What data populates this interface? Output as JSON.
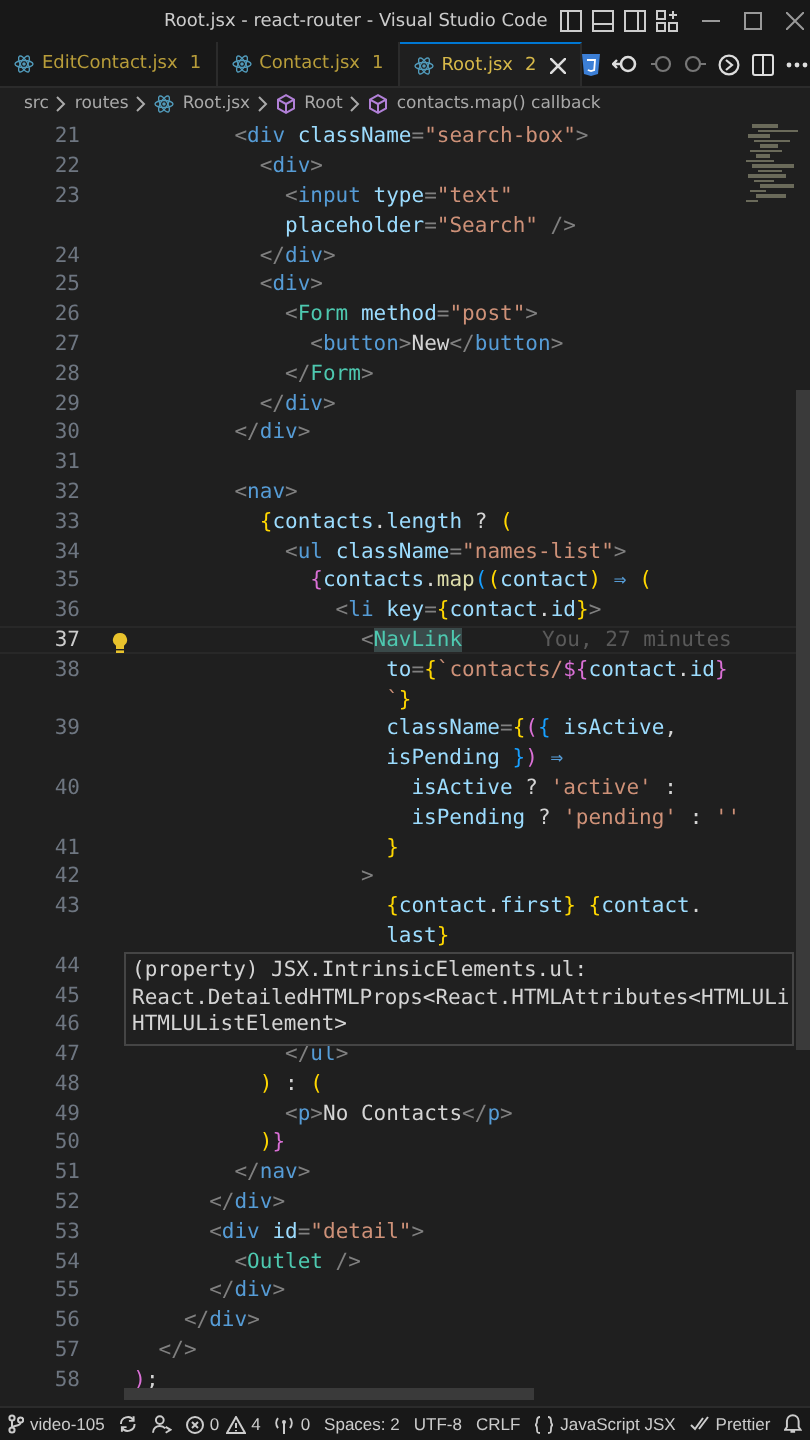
{
  "window": {
    "title": "Root.jsx - react-router - Visual Studio Code"
  },
  "tabs": [
    {
      "label": "EditContact.jsx",
      "badge": "1",
      "selected": false
    },
    {
      "label": "Contact.jsx",
      "badge": "1",
      "selected": false
    },
    {
      "label": "Root.jsx",
      "badge": "2",
      "selected": true
    }
  ],
  "breadcrumb": [
    {
      "label": "src",
      "kind": "folder"
    },
    {
      "label": "routes",
      "kind": "folder"
    },
    {
      "label": "Root.jsx",
      "kind": "file"
    },
    {
      "label": "Root",
      "kind": "symbol"
    },
    {
      "label": "contacts.map() callback",
      "kind": "symbol"
    }
  ],
  "editor": {
    "lines": [
      {
        "n": "21",
        "current": false,
        "tokens": [
          {
            "kind": "punct",
            "text": "          <"
          },
          {
            "kind": "tag",
            "text": "div"
          },
          {
            "kind": "attr",
            "text": " className"
          },
          {
            "kind": "punct",
            "text": "="
          },
          {
            "kind": "string",
            "text": "\"search-box\""
          },
          {
            "kind": "punct",
            "text": ">"
          }
        ]
      },
      {
        "n": "22",
        "current": false,
        "tokens": [
          {
            "kind": "punct",
            "text": "            <"
          },
          {
            "kind": "tag",
            "text": "div"
          },
          {
            "kind": "punct",
            "text": ">"
          }
        ]
      },
      {
        "n": "23",
        "current": false,
        "tokens": [
          {
            "kind": "punct",
            "text": "              <"
          },
          {
            "kind": "tag",
            "text": "input"
          },
          {
            "kind": "attr",
            "text": " type"
          },
          {
            "kind": "punct",
            "text": "="
          },
          {
            "kind": "string",
            "text": "\"text\""
          }
        ]
      },
      {
        "current": false,
        "tokens": [
          {
            "kind": "attr",
            "text": "              placeholder"
          },
          {
            "kind": "punct",
            "text": "="
          },
          {
            "kind": "string",
            "text": "\"Search\""
          },
          {
            "kind": "punct",
            "text": " />"
          }
        ]
      },
      {
        "n": "24",
        "current": false,
        "tokens": [
          {
            "kind": "punct",
            "text": "            </"
          },
          {
            "kind": "tag",
            "text": "div"
          },
          {
            "kind": "punct",
            "text": ">"
          }
        ]
      },
      {
        "n": "25",
        "current": false,
        "tokens": [
          {
            "kind": "punct",
            "text": "            <"
          },
          {
            "kind": "tag",
            "text": "div"
          },
          {
            "kind": "punct",
            "text": ">"
          }
        ]
      },
      {
        "n": "26",
        "current": false,
        "tokens": [
          {
            "kind": "punct",
            "text": "              <"
          },
          {
            "kind": "component",
            "text": "Form"
          },
          {
            "kind": "attr",
            "text": " method"
          },
          {
            "kind": "punct",
            "text": "="
          },
          {
            "kind": "string",
            "text": "\"post\""
          },
          {
            "kind": "punct",
            "text": ">"
          }
        ]
      },
      {
        "n": "27",
        "current": false,
        "tokens": [
          {
            "kind": "punct",
            "text": "                <"
          },
          {
            "kind": "tag",
            "text": "button"
          },
          {
            "kind": "punct",
            "text": ">"
          },
          {
            "kind": "plain",
            "text": "New"
          },
          {
            "kind": "punct",
            "text": "</"
          },
          {
            "kind": "tag",
            "text": "button"
          },
          {
            "kind": "punct",
            "text": ">"
          }
        ]
      },
      {
        "n": "28",
        "current": false,
        "tokens": [
          {
            "kind": "punct",
            "text": "              </"
          },
          {
            "kind": "component",
            "text": "Form"
          },
          {
            "kind": "punct",
            "text": ">"
          }
        ]
      },
      {
        "n": "29",
        "current": false,
        "tokens": [
          {
            "kind": "punct",
            "text": "            </"
          },
          {
            "kind": "tag",
            "text": "div"
          },
          {
            "kind": "punct",
            "text": ">"
          }
        ]
      },
      {
        "n": "30",
        "current": false,
        "tokens": [
          {
            "kind": "punct",
            "text": "          </"
          },
          {
            "kind": "tag",
            "text": "div"
          },
          {
            "kind": "punct",
            "text": ">"
          }
        ]
      },
      {
        "n": "31",
        "current": false
      },
      {
        "n": "32",
        "current": false,
        "tokens": [
          {
            "kind": "punct",
            "text": "          <"
          },
          {
            "kind": "tag",
            "text": "nav"
          },
          {
            "kind": "punct",
            "text": ">"
          }
        ]
      },
      {
        "n": "33",
        "current": false,
        "tokens": [
          {
            "kind": "bracket1",
            "text": "            {"
          },
          {
            "kind": "var",
            "text": "contacts"
          },
          {
            "kind": "plain",
            "text": "."
          },
          {
            "kind": "var",
            "text": "length"
          },
          {
            "kind": "plain",
            "text": " ? "
          },
          {
            "kind": "bracket1",
            "text": "("
          }
        ]
      },
      {
        "n": "34",
        "current": false,
        "tokens": [
          {
            "kind": "punct",
            "text": "              <"
          },
          {
            "kind": "tag",
            "text": "ul"
          },
          {
            "kind": "attr",
            "text": " className"
          },
          {
            "kind": "punct",
            "text": "="
          },
          {
            "kind": "string",
            "text": "\"names-list\""
          },
          {
            "kind": "punct",
            "text": ">"
          }
        ]
      },
      {
        "n": "35",
        "current": false,
        "tokens": [
          {
            "kind": "bracket2",
            "text": "                {"
          },
          {
            "kind": "var",
            "text": "contacts"
          },
          {
            "kind": "plain",
            "text": "."
          },
          {
            "kind": "func",
            "text": "map"
          },
          {
            "kind": "bracket3",
            "text": "("
          },
          {
            "kind": "bracket1",
            "text": "("
          },
          {
            "kind": "var",
            "text": "contact"
          },
          {
            "kind": "bracket1",
            "text": ")"
          },
          {
            "kind": "tag",
            "text": " ⇒ "
          },
          {
            "kind": "bracket1",
            "text": "("
          }
        ]
      },
      {
        "n": "36",
        "current": false,
        "tokens": [
          {
            "kind": "punct",
            "text": "                  <"
          },
          {
            "kind": "tag",
            "text": "li"
          },
          {
            "kind": "attr",
            "text": " key"
          },
          {
            "kind": "punct",
            "text": "="
          },
          {
            "kind": "bracket1",
            "text": "{"
          },
          {
            "kind": "var",
            "text": "contact"
          },
          {
            "kind": "plain",
            "text": "."
          },
          {
            "kind": "var",
            "text": "id"
          },
          {
            "kind": "bracket1",
            "text": "}"
          },
          {
            "kind": "punct",
            "text": ">"
          }
        ]
      },
      {
        "n": "37",
        "current": true,
        "blame": "You, 27 minutes",
        "tokens": [
          {
            "kind": "punct",
            "text": "                    <"
          },
          {
            "kind": "highlight",
            "text": "NavLink"
          }
        ]
      },
      {
        "n": "38",
        "current": false,
        "tokens": [
          {
            "kind": "attr",
            "text": "                      to"
          },
          {
            "kind": "punct",
            "text": "="
          },
          {
            "kind": "bracket1",
            "text": "{"
          },
          {
            "kind": "string",
            "text": "`contacts/"
          },
          {
            "kind": "bracket2",
            "text": "${"
          },
          {
            "kind": "var",
            "text": "contact"
          },
          {
            "kind": "plain",
            "text": "."
          },
          {
            "kind": "var",
            "text": "id"
          },
          {
            "kind": "bracket2",
            "text": "}"
          }
        ]
      },
      {
        "current": false,
        "tokens": [
          {
            "kind": "string",
            "text": "                      `"
          },
          {
            "kind": "bracket1",
            "text": "}"
          }
        ]
      },
      {
        "n": "39",
        "current": false,
        "tokens": [
          {
            "kind": "attr",
            "text": "                      className"
          },
          {
            "kind": "punct",
            "text": "="
          },
          {
            "kind": "bracket1",
            "text": "{"
          },
          {
            "kind": "bracket2",
            "text": "("
          },
          {
            "kind": "bracket3",
            "text": "{"
          },
          {
            "kind": "var",
            "text": " isActive"
          },
          {
            "kind": "plain",
            "text": ","
          }
        ]
      },
      {
        "current": false,
        "tokens": [
          {
            "kind": "var",
            "text": "                      isPending"
          },
          {
            "kind": "bracket3",
            "text": " }"
          },
          {
            "kind": "bracket2",
            "text": ")"
          },
          {
            "kind": "tag",
            "text": " ⇒"
          }
        ]
      },
      {
        "n": "40",
        "current": false,
        "tokens": [
          {
            "kind": "var",
            "text": "                        isActive"
          },
          {
            "kind": "plain",
            "text": " ? "
          },
          {
            "kind": "string",
            "text": "'active'"
          },
          {
            "kind": "plain",
            "text": " :"
          }
        ]
      },
      {
        "current": false,
        "tokens": [
          {
            "kind": "var",
            "text": "                        isPending"
          },
          {
            "kind": "plain",
            "text": " ? "
          },
          {
            "kind": "string",
            "text": "'pending'"
          },
          {
            "kind": "plain",
            "text": " : "
          },
          {
            "kind": "string",
            "text": "''"
          }
        ]
      },
      {
        "n": "41",
        "current": false,
        "tokens": [
          {
            "kind": "bracket1",
            "text": "                      }"
          }
        ]
      },
      {
        "n": "42",
        "current": false,
        "tokens": [
          {
            "kind": "punct",
            "text": "                    >"
          }
        ]
      },
      {
        "n": "43",
        "current": false,
        "tokens": [
          {
            "kind": "bracket1",
            "text": "                      {"
          },
          {
            "kind": "var",
            "text": "contact"
          },
          {
            "kind": "plain",
            "text": "."
          },
          {
            "kind": "var",
            "text": "first"
          },
          {
            "kind": "bracket1",
            "text": "}"
          },
          {
            "kind": "bracket1",
            "text": " {"
          },
          {
            "kind": "var",
            "text": "contact"
          },
          {
            "kind": "plain",
            "text": "."
          }
        ]
      },
      {
        "current": false,
        "tokens": [
          {
            "kind": "var",
            "text": "                      last"
          },
          {
            "kind": "bracket1",
            "text": "}"
          }
        ]
      },
      {
        "n": "44",
        "current": false
      },
      {
        "n": "45",
        "current": false
      },
      {
        "n": "46",
        "current": false
      },
      {
        "n": "47",
        "current": false,
        "tokens": [
          {
            "kind": "punct",
            "text": "              </"
          },
          {
            "kind": "tag",
            "text": "ul"
          },
          {
            "kind": "punct",
            "text": ">"
          }
        ]
      },
      {
        "n": "48",
        "current": false,
        "tokens": [
          {
            "kind": "bracket1",
            "text": "            )"
          },
          {
            "kind": "plain",
            "text": " : "
          },
          {
            "kind": "bracket1",
            "text": "("
          }
        ]
      },
      {
        "n": "49",
        "current": false,
        "tokens": [
          {
            "kind": "punct",
            "text": "              <"
          },
          {
            "kind": "tag",
            "text": "p"
          },
          {
            "kind": "punct",
            "text": ">"
          },
          {
            "kind": "plain",
            "text": "No Contacts"
          },
          {
            "kind": "punct",
            "text": "</"
          },
          {
            "kind": "tag",
            "text": "p"
          },
          {
            "kind": "punct",
            "text": ">"
          }
        ]
      },
      {
        "n": "50",
        "current": false,
        "tokens": [
          {
            "kind": "bracket1",
            "text": "            )"
          },
          {
            "kind": "bracket2",
            "text": "}"
          }
        ]
      },
      {
        "n": "51",
        "current": false,
        "tokens": [
          {
            "kind": "punct",
            "text": "          </"
          },
          {
            "kind": "tag",
            "text": "nav"
          },
          {
            "kind": "punct",
            "text": ">"
          }
        ]
      },
      {
        "n": "52",
        "current": false,
        "tokens": [
          {
            "kind": "punct",
            "text": "        </"
          },
          {
            "kind": "tag",
            "text": "div"
          },
          {
            "kind": "punct",
            "text": ">"
          }
        ]
      },
      {
        "n": "53",
        "current": false,
        "tokens": [
          {
            "kind": "punct",
            "text": "        <"
          },
          {
            "kind": "tag",
            "text": "div"
          },
          {
            "kind": "attr",
            "text": " id"
          },
          {
            "kind": "punct",
            "text": "="
          },
          {
            "kind": "string",
            "text": "\"detail\""
          },
          {
            "kind": "punct",
            "text": ">"
          }
        ]
      },
      {
        "n": "54",
        "current": false,
        "tokens": [
          {
            "kind": "punct",
            "text": "          <"
          },
          {
            "kind": "component",
            "text": "Outlet"
          },
          {
            "kind": "punct",
            "text": " />"
          }
        ]
      },
      {
        "n": "55",
        "current": false,
        "tokens": [
          {
            "kind": "punct",
            "text": "        </"
          },
          {
            "kind": "tag",
            "text": "div"
          },
          {
            "kind": "punct",
            "text": ">"
          }
        ]
      },
      {
        "n": "56",
        "current": false,
        "tokens": [
          {
            "kind": "punct",
            "text": "      </"
          },
          {
            "kind": "tag",
            "text": "div"
          },
          {
            "kind": "punct",
            "text": ">"
          }
        ]
      },
      {
        "n": "57",
        "current": false,
        "tokens": [
          {
            "kind": "punct",
            "text": "    </>"
          }
        ]
      },
      {
        "n": "58",
        "current": false,
        "tokens": [
          {
            "kind": "bracket2",
            "text": "  )"
          },
          {
            "kind": "plain",
            "text": ";"
          }
        ]
      }
    ],
    "hover": [
      "(property) JSX.IntrinsicElements.ul:",
      "React.DetailedHTMLProps<React.HTMLAttributes<HTMLULi",
      "HTMLUListElement>"
    ]
  },
  "status_bar": {
    "branch": "video-105",
    "errors": "0",
    "warnings": "4",
    "ports": "0",
    "items": [
      "Spaces: 2",
      "UTF-8",
      "CRLF"
    ],
    "language": "JavaScript JSX",
    "formatter": "Prettier"
  }
}
